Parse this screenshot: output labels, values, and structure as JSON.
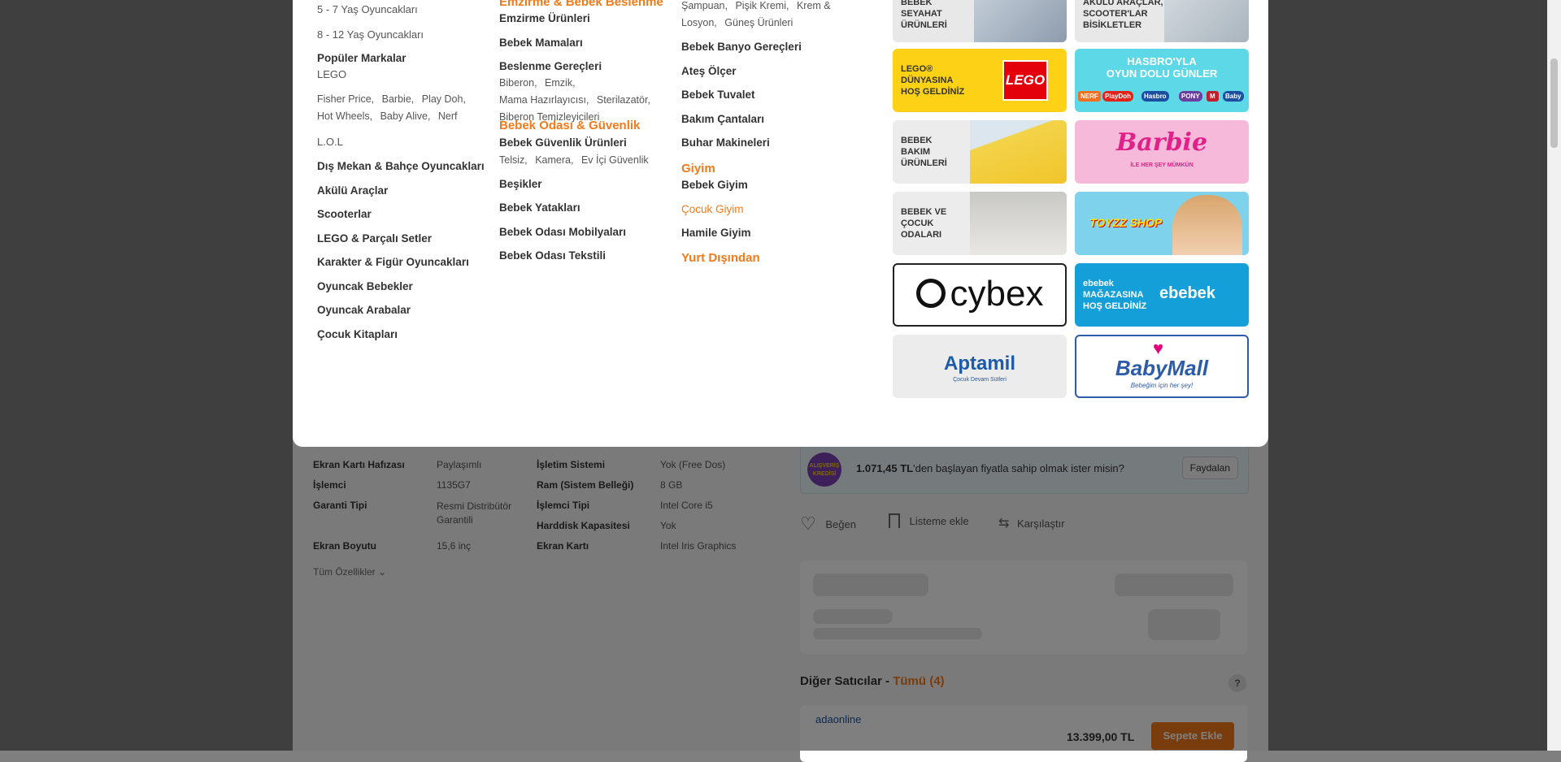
{
  "menu": {
    "col1": {
      "items_top": [
        "5 - 7 Yaş Oyuncakları",
        "8 - 12 Yaş Oyuncakları"
      ],
      "popular_title": "Popüler Markalar",
      "popular_first": "LEGO",
      "popular_brands": [
        "Fisher Price,",
        "Barbie,",
        "Play Doh,",
        "Hot Wheels,",
        "Baby Alive,",
        "Nerf"
      ],
      "lol": "L.O.L",
      "items": [
        "Dış Mekan & Bahçe Oyuncakları",
        "Akülü Araçlar",
        "Scooterlar",
        "LEGO & Parçalı Setler",
        "Karakter & Figür Oyuncakları",
        "Oyuncak Bebekler",
        "Oyuncak Arabalar",
        "Çocuk Kitapları"
      ]
    },
    "col2": {
      "heading1": "Emzirme & Bebek Beslenme",
      "emzirme": "Emzirme Ürünleri",
      "mamalar": "Bebek Mamaları",
      "gerecler": "Beslenme Gereçleri",
      "gerecler_subs": [
        "Biberon,",
        "Emzik,",
        "Mama Hazırlayıcısı,",
        "Sterilazatör,",
        "Biberon Temizleyicileri"
      ],
      "heading2": "Bebek Odası & Güvenlik",
      "guvenlik": "Bebek Güvenlik Ürünleri",
      "guvenlik_subs": [
        "Telsiz,",
        "Kamera,",
        "Ev İçi Güvenlik"
      ],
      "items": [
        "Beşikler",
        "Bebek Yatakları",
        "Bebek Odası Mobilyaları",
        "Bebek Odası Tekstili"
      ]
    },
    "col3": {
      "top_subs": [
        "Şampuan,",
        "Pişik Kremi,",
        "Krem &",
        "Losyon,",
        "Güneş Ürünleri"
      ],
      "items1": [
        "Bebek Banyo Gereçleri",
        "Ateş Ölçer",
        "Bebek Tuvalet",
        "Bakım Çantaları",
        "Buhar Makineleri"
      ],
      "heading_giyim": "Giyim",
      "bebek_giyim": "Bebek Giyim",
      "cocuk_giyim": "Çocuk Giyim",
      "hamile_giyim": "Hamile Giyim",
      "heading_yurt": "Yurt Dışından"
    },
    "tiles": {
      "travel": "BEBEK\nSEYAHAT\nÜRÜNLERİ",
      "scooters": "AKÜLÜ ARAÇLAR,\nSCOOTER'LAR\nBİSİKLETLER",
      "lego_text": "LEGO®\nDÜNYASINA\nHOŞ GELDİNİZ",
      "lego_logo": "LEGO",
      "hasbro_text": "HASBRO'YLA\nOYUN DOLU GÜNLER",
      "hasbro_brands": [
        "NERF",
        "PlayDoh",
        "Hasbro",
        "PONY",
        "M",
        "Baby"
      ],
      "care": "BEBEK\nBAKIM\nÜRÜNLERİ",
      "barbie": "Barbie",
      "barbie_sub": "İLE HER ŞEY MÜMKÜN",
      "room": "BEBEK VE\nÇOCUK\nODALARI",
      "toyzz": "TOYZZ SHOP",
      "cybex": "cybex",
      "ebebek_text": "ebebek\nMAĞAZASINA\nHOŞ GELDİNİZ",
      "ebebek_logo": "ebebek",
      "aptamil": "Aptamil",
      "aptamil_sub": "Çocuk Devam Sütleri",
      "babymall": "BabyMall",
      "babymall_sub": "Bebeğim için her şey!"
    }
  },
  "specs": {
    "left": [
      {
        "k": "Ekran Kartı Hafızası",
        "v": "Paylaşımlı"
      },
      {
        "k": "İşlemci",
        "v": "1135G7"
      },
      {
        "k": "Garanti Tipi",
        "v": "Resmi Distribütör Garantili"
      },
      {
        "k": "Ekran Boyutu",
        "v": "15,6 inç"
      }
    ],
    "right": [
      {
        "k": "İşletim Sistemi",
        "v": "Yok (Free Dos)"
      },
      {
        "k": "Ram (Sistem Belleği)",
        "v": "8 GB"
      },
      {
        "k": "İşlemci Tipi",
        "v": "Intel Core i5"
      },
      {
        "k": "Harddisk Kapasitesi",
        "v": "Yok"
      },
      {
        "k": "Ekran Kartı",
        "v": "Intel Iris Graphics"
      }
    ],
    "all_features": "Tüm Özellikler"
  },
  "credit": {
    "badge": "ALIŞVERİŞ KREDİSİ",
    "amount": "1.071,45 TL",
    "text": "'den başlayan fiyatla sahip olmak ister misin?",
    "button": "Faydalan"
  },
  "actions": {
    "like": "Beğen",
    "list": "Listeme ekle",
    "compare": "Karşılaştır"
  },
  "sellers": {
    "title": "Diğer Satıcılar - ",
    "all": "Tümü (4)",
    "help": "?",
    "seller_name": "adaonline",
    "price": "13.399,00 TL",
    "add_cart": "Sepete Ekle"
  },
  "colors": {
    "accent": "#f27a1a",
    "lego_yellow": "#fcd116",
    "hasbro_cyan": "#5cd8e6",
    "barbie_pink": "#f7b9d9",
    "ebebek_blue": "#159fd8"
  }
}
